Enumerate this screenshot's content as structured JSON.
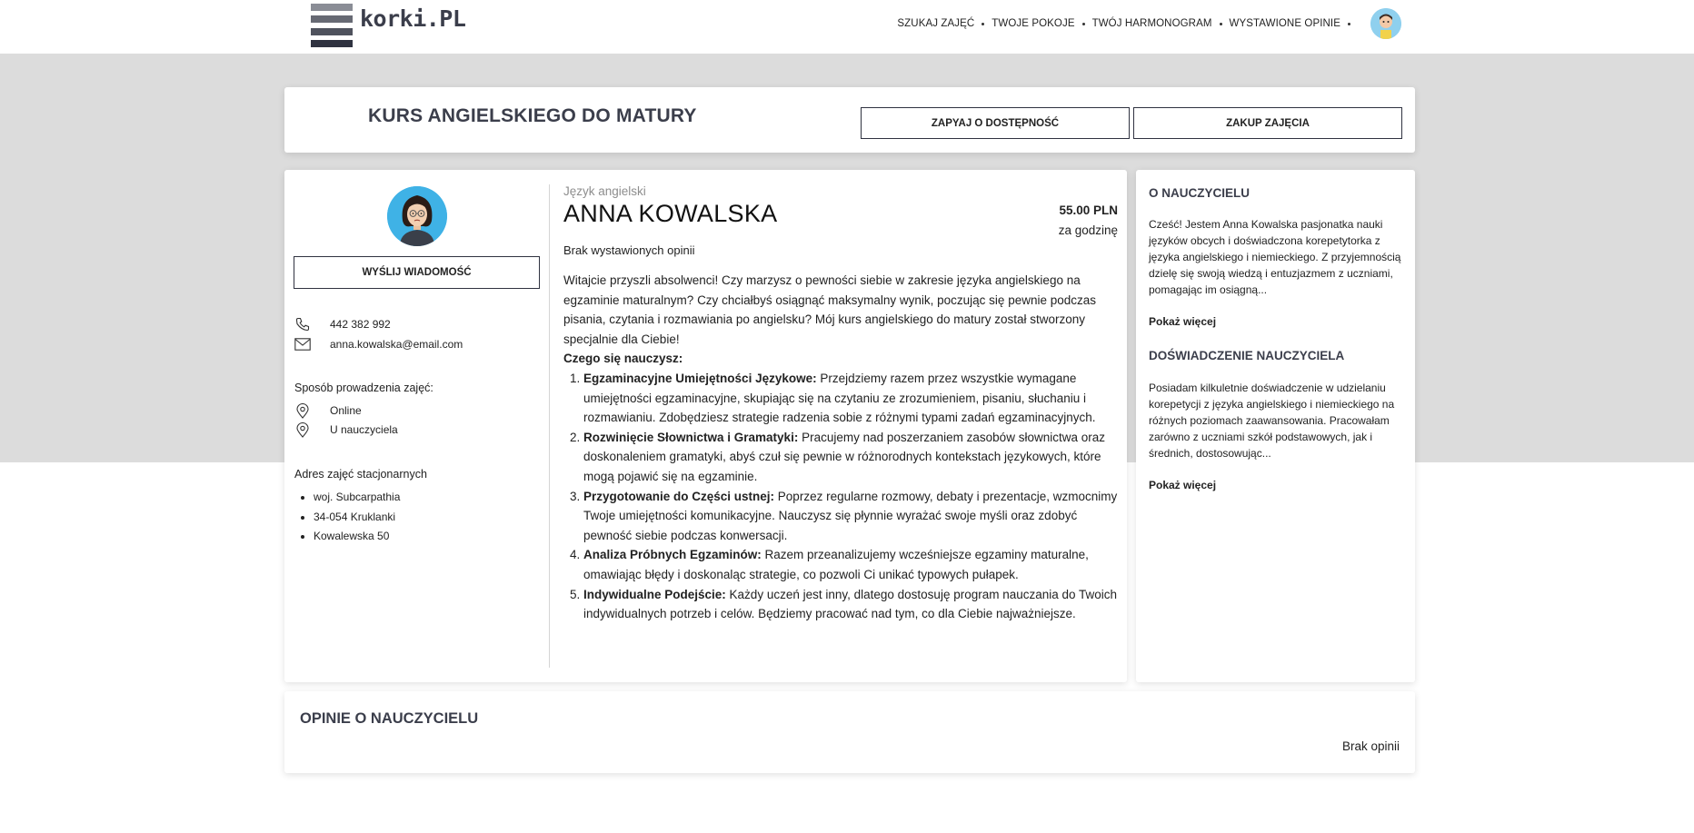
{
  "header": {
    "logo_text": "korki.PL",
    "nav": [
      {
        "label": "SZUKAJ ZAJĘĆ"
      },
      {
        "label": "TWOJE POKOJE"
      },
      {
        "label": "TWÓJ HARMONOGRAM"
      },
      {
        "label": "WYSTAWIONE OPINIE"
      }
    ],
    "avatar_icon": "user-avatar-icon"
  },
  "course": {
    "title": "KURS ANGIELSKIEGO DO MATURY",
    "check_availability_label": "ZAPYAJ O DOSTĘPNOŚĆ",
    "buy_label": "ZAKUP ZAJĘCIA"
  },
  "teacher": {
    "send_message_label": "WYŚLIJ WIADOMOŚĆ",
    "phone": "442 382 992",
    "email": "anna.kowalska@email.com",
    "mode_label": "Sposób prowadzenia zajęć:",
    "modes": [
      "Online",
      "U nauczyciela"
    ],
    "address_label": "Adres zajęć stacjonarnych",
    "address": [
      "woj. Subcarpathia",
      "34-054 Kruklanki",
      "Kowalewska 50"
    ]
  },
  "offer": {
    "language": "Język angielski",
    "name": "ANNA KOWALSKA",
    "price": "55.00 PLN",
    "price_unit": "za godzinę",
    "reviews_status": "Brak wystawionych opinii",
    "intro": "Witajcie przyszli absolwenci! Czy marzysz o pewności siebie w zakresie języka angielskiego na egzaminie maturalnym? Czy chciałbyś osiągnąć maksymalny wynik, poczując się pewnie podczas pisania, czytania i rozmawiania po angielsku? Mój kurs angielskiego do matury został stworzony specjalnie dla Ciebie!",
    "learn_title": "Czego się nauczysz:",
    "items": [
      {
        "title": "Egzaminacyjne Umiejętności Językowe:",
        "text": " Przejdziemy razem przez wszystkie wymagane umiejętności egzaminacyjne, skupiając się na czytaniu ze zrozumieniem, pisaniu, słuchaniu i rozmawianiu. Zdobędziesz strategie radzenia sobie z różnymi typami zadań egzaminacyjnych."
      },
      {
        "title": "Rozwinięcie Słownictwa i Gramatyki:",
        "text": " Pracujemy nad poszerzaniem zasobów słownictwa oraz doskonaleniem gramatyki, abyś czuł się pewnie w różnorodnych kontekstach językowych, które mogą pojawić się na egzaminie."
      },
      {
        "title": "Przygotowanie do Części ustnej:",
        "text": " Poprzez regularne rozmowy, debaty i prezentacje, wzmocnimy Twoje umiejętności komunikacyjne. Nauczysz się płynnie wyrażać swoje myśli oraz zdobyć pewność siebie podczas konwersacji."
      },
      {
        "title": "Analiza Próbnych Egzaminów:",
        "text": " Razem przeanalizujemy wcześniejsze egzaminy maturalne, omawiając błędy i doskonaląc strategie, co pozwoli Ci unikać typowych pułapek."
      },
      {
        "title": "Indywidualne Podejście:",
        "text": " Każdy uczeń jest inny, dlatego dostosuję program nauczania do Twoich indywidualnych potrzeb i celów. Będziemy pracować nad tym, co dla Ciebie najważniejsze."
      }
    ]
  },
  "about": {
    "title": "O NAUCZYCIELU",
    "text": "Cześć! Jestem Anna Kowalska pasjonatka nauki języków obcych i doświadczona korepetytorka z języka angielskiego i niemieckiego. Z przyjemnością dzielę się swoją wiedzą i entuzjazmem z uczniami, pomagając im osiągną...",
    "more": "Pokaż więcej"
  },
  "experience": {
    "title": "DOŚWIADCZENIE NAUCZYCIELA",
    "text": "Posiadam kilkuletnie doświadczenie w udzielaniu korepetycji z języka angielskiego i niemieckiego na różnych poziomach zaawansowania. Pracowałam zarówno z uczniami szkół podstawowych, jak i średnich, dostosowując...",
    "more": "Pokaż więcej"
  },
  "reviews": {
    "title": "OPINIE O NAUCZYCIELU",
    "empty": "Brak opinii"
  }
}
